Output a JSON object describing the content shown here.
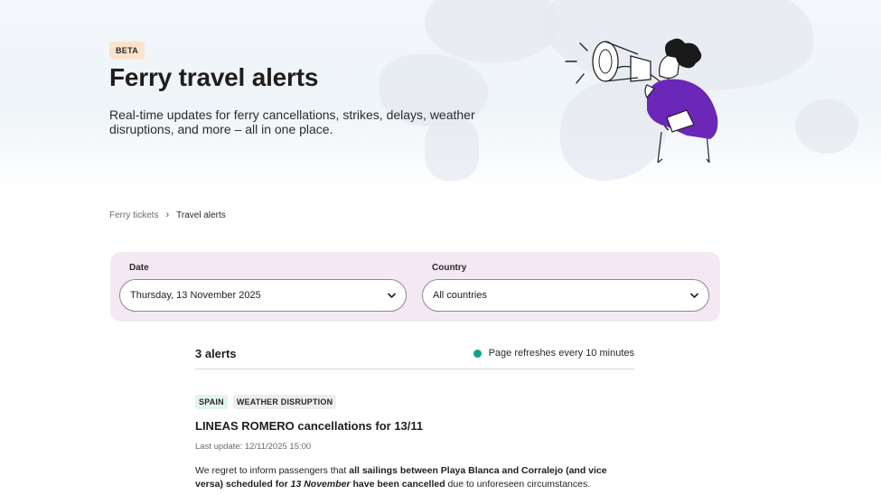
{
  "hero": {
    "badge": "BETA",
    "title": "Ferry travel alerts",
    "subtitle": "Real-time updates for ferry cancellations, strikes, delays, weather disruptions, and more – all in one place."
  },
  "breadcrumb": {
    "home": "Ferry tickets",
    "separator": "›",
    "current": "Travel alerts"
  },
  "filters": {
    "date_label": "Date",
    "date_value": "Thursday, 13 November 2025",
    "country_label": "Country",
    "country_value": "All countries"
  },
  "alerts": {
    "count_label": "3 alerts",
    "refresh_text": "Page refreshes every 10 minutes",
    "refresh_dot_color": "#11a38a",
    "items": [
      {
        "country_tag": "SPAIN",
        "type_tag": "WEATHER DISRUPTION",
        "title": "LINEAS ROMERO cancellations for 13/11",
        "updated": "Last update: 12/11/2025 15:00",
        "body": {
          "t1": "We regret to inform passengers that ",
          "b1": "all sailings between Playa Blanca and Corralejo (and vice versa) scheduled for ",
          "i1": "13 November",
          "b2": " have been cancelled",
          "t2": " due to unforeseen circumstances."
        }
      }
    ]
  },
  "icons": [
    "chevron-down-icon",
    "megaphone-illustration"
  ],
  "colors": {
    "filter_bg": "#f4e8f2",
    "beta_bg": "#fbe3c9",
    "purple": "#6a27b8"
  }
}
